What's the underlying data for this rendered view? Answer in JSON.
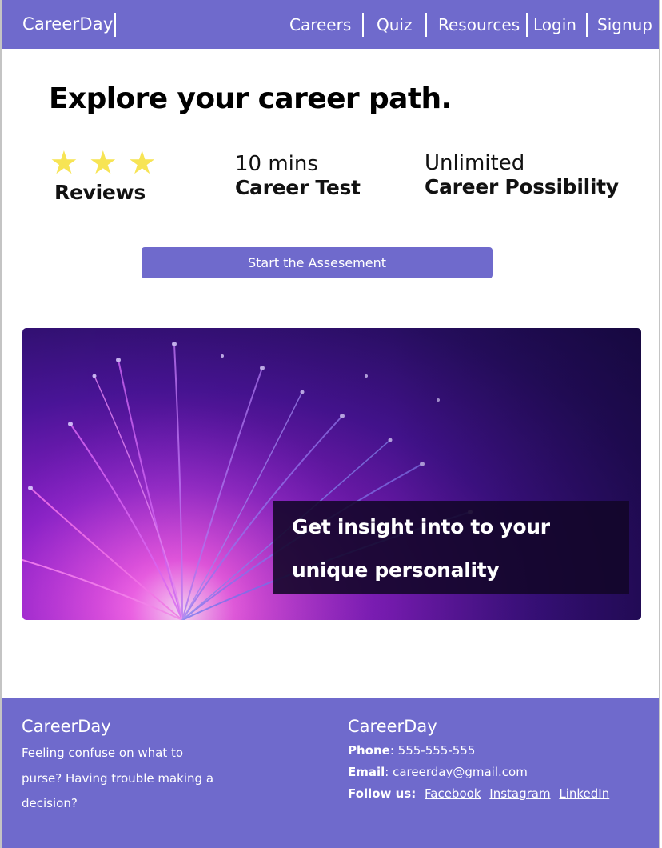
{
  "nav": {
    "brand": "CareerDay",
    "links": [
      {
        "label": "Careers"
      },
      {
        "label": "Quiz"
      },
      {
        "label": "Resources"
      },
      {
        "label": "Login"
      },
      {
        "label": "Signup"
      }
    ]
  },
  "hero": {
    "title": "Explore your career path.",
    "stats": [
      {
        "top": "",
        "bottom": "Reviews",
        "stars": 3
      },
      {
        "top": "10 mins",
        "bottom": "Career Test"
      },
      {
        "top": "Unlimited",
        "bottom": "Career Possibility"
      }
    ],
    "cta_label": "Start the Assesement"
  },
  "banner": {
    "caption": "Get insight into to your unique personality"
  },
  "footer": {
    "brand_left": "CareerDay",
    "tagline": "Feeling confuse on what to purse? Having trouble making a decision?",
    "brand_right": "CareerDay",
    "phone_label": "Phone",
    "phone_value": ": 555-555-555",
    "email_label": "Email",
    "email_value": ": careerday@gmail.com",
    "follow_label": "Follow us:",
    "social": [
      "Facebook",
      "Instagram",
      "LinkedIn"
    ]
  },
  "colors": {
    "primary": "#6f6acc",
    "star": "#f7e454",
    "text": "#111111"
  }
}
